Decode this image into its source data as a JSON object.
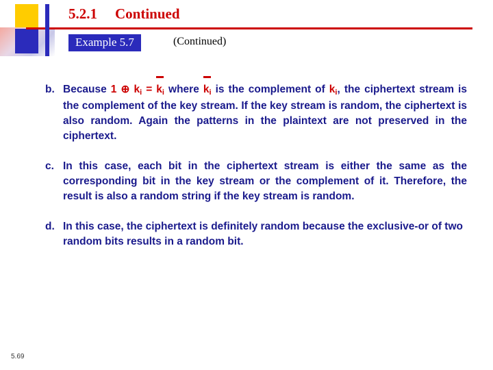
{
  "header": {
    "section_number": "5.2.1",
    "section_title": "Continued",
    "example_label": "Example 5.7",
    "continued_note": "(Continued)"
  },
  "items": [
    {
      "marker": "b.",
      "lead": "Because",
      "formula": {
        "one": "1",
        "op": "⊕",
        "k1": "k",
        "k1sub": "i",
        "eq": "=",
        "k2": "k",
        "k2sub": "i"
      },
      "mid": "where",
      "k3": "k",
      "k3sub": "i",
      "after_k3": "is the complement of",
      "k4": "k",
      "k4sub": "i",
      "rest": ", the ciphertext stream is the complement of the key stream. If the key stream is random, the ciphertext is also random. Again the patterns in the plaintext are not preserved in the ciphertext."
    },
    {
      "marker": "c.",
      "text": "In this case, each bit in the ciphertext stream is either the same as the corresponding bit in the key stream or the complement of it. Therefore, the result is also a random string if the key stream is random."
    },
    {
      "marker": "d.",
      "text": "In this case, the ciphertext is definitely random because the exclusive-or of two random bits results in a random bit."
    }
  ],
  "footer": {
    "page_number": "5.69"
  },
  "colors": {
    "title_red": "#cc0000",
    "body_blue": "#1a1a8c",
    "chip_blue": "#2b2bbb",
    "accent_yellow": "#ffcc00"
  }
}
